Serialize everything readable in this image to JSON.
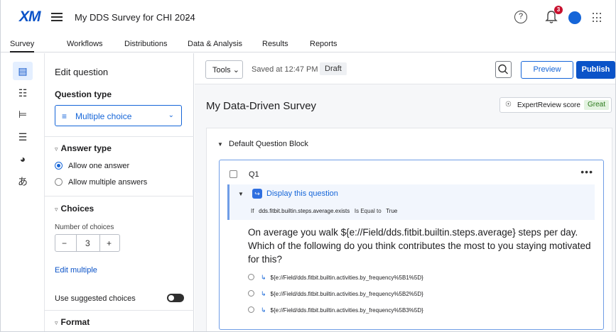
{
  "app": {
    "logo": "XM",
    "project_title": "My DDS Survey for CHI 2024",
    "notification_count": "3"
  },
  "tabs": [
    "Survey",
    "Workflows",
    "Distributions",
    "Data & Analysis",
    "Results",
    "Reports"
  ],
  "rail_icons": [
    "survey-builder-icon",
    "survey-flow-icon",
    "look-and-feel-icon",
    "survey-options-icon",
    "tools-icon",
    "translate-icon"
  ],
  "edit_panel": {
    "title": "Edit question",
    "question_type_label": "Question type",
    "question_type_value": "Multiple choice",
    "answer_type": {
      "header": "Answer type",
      "options": [
        "Allow one answer",
        "Allow multiple answers"
      ],
      "selected": 0
    },
    "choices": {
      "header": "Choices",
      "number_label": "Number of choices",
      "count": "3",
      "minus": "−",
      "plus": "+",
      "edit_multiple": "Edit multiple"
    },
    "suggested_label": "Use suggested choices",
    "format_header": "Format"
  },
  "toolbar": {
    "tools_label": "Tools",
    "saved_text": "Saved at 12:47 PM",
    "draft_badge": "Draft",
    "preview_label": "Preview",
    "publish_label": "Publish"
  },
  "survey": {
    "title": "My Data-Driven Survey",
    "expert_review_label": "ExpertReview score",
    "expert_review_score": "Great",
    "block_name": "Default Question Block",
    "question": {
      "id": "Q1",
      "more": "•••",
      "logic_title": "Display this question",
      "logic_if": "If",
      "logic_field": "dds.fitbit.builtin.steps.average.exists",
      "logic_op": "Is Equal to",
      "logic_value": "True",
      "text": "On average you walk ${e://Field/dds.fitbit.builtin.steps.average} steps per day. Which of the following do you think contributes the most to you staying motivated for this?",
      "choices": [
        "${e://Field/dds.fitbit.builtin.activities.by_frequency%5B1%5D}",
        "${e://Field/dds.fitbit.builtin.activities.by_frequency%5B2%5D}",
        "${e://Field/dds.fitbit.builtin.activities.by_frequency%5B3%5D}"
      ]
    }
  },
  "colors": {
    "brand": "#0b53c8",
    "accent": "#1565d8",
    "great": "#2b7a1b",
    "badge": "#c8102e"
  }
}
